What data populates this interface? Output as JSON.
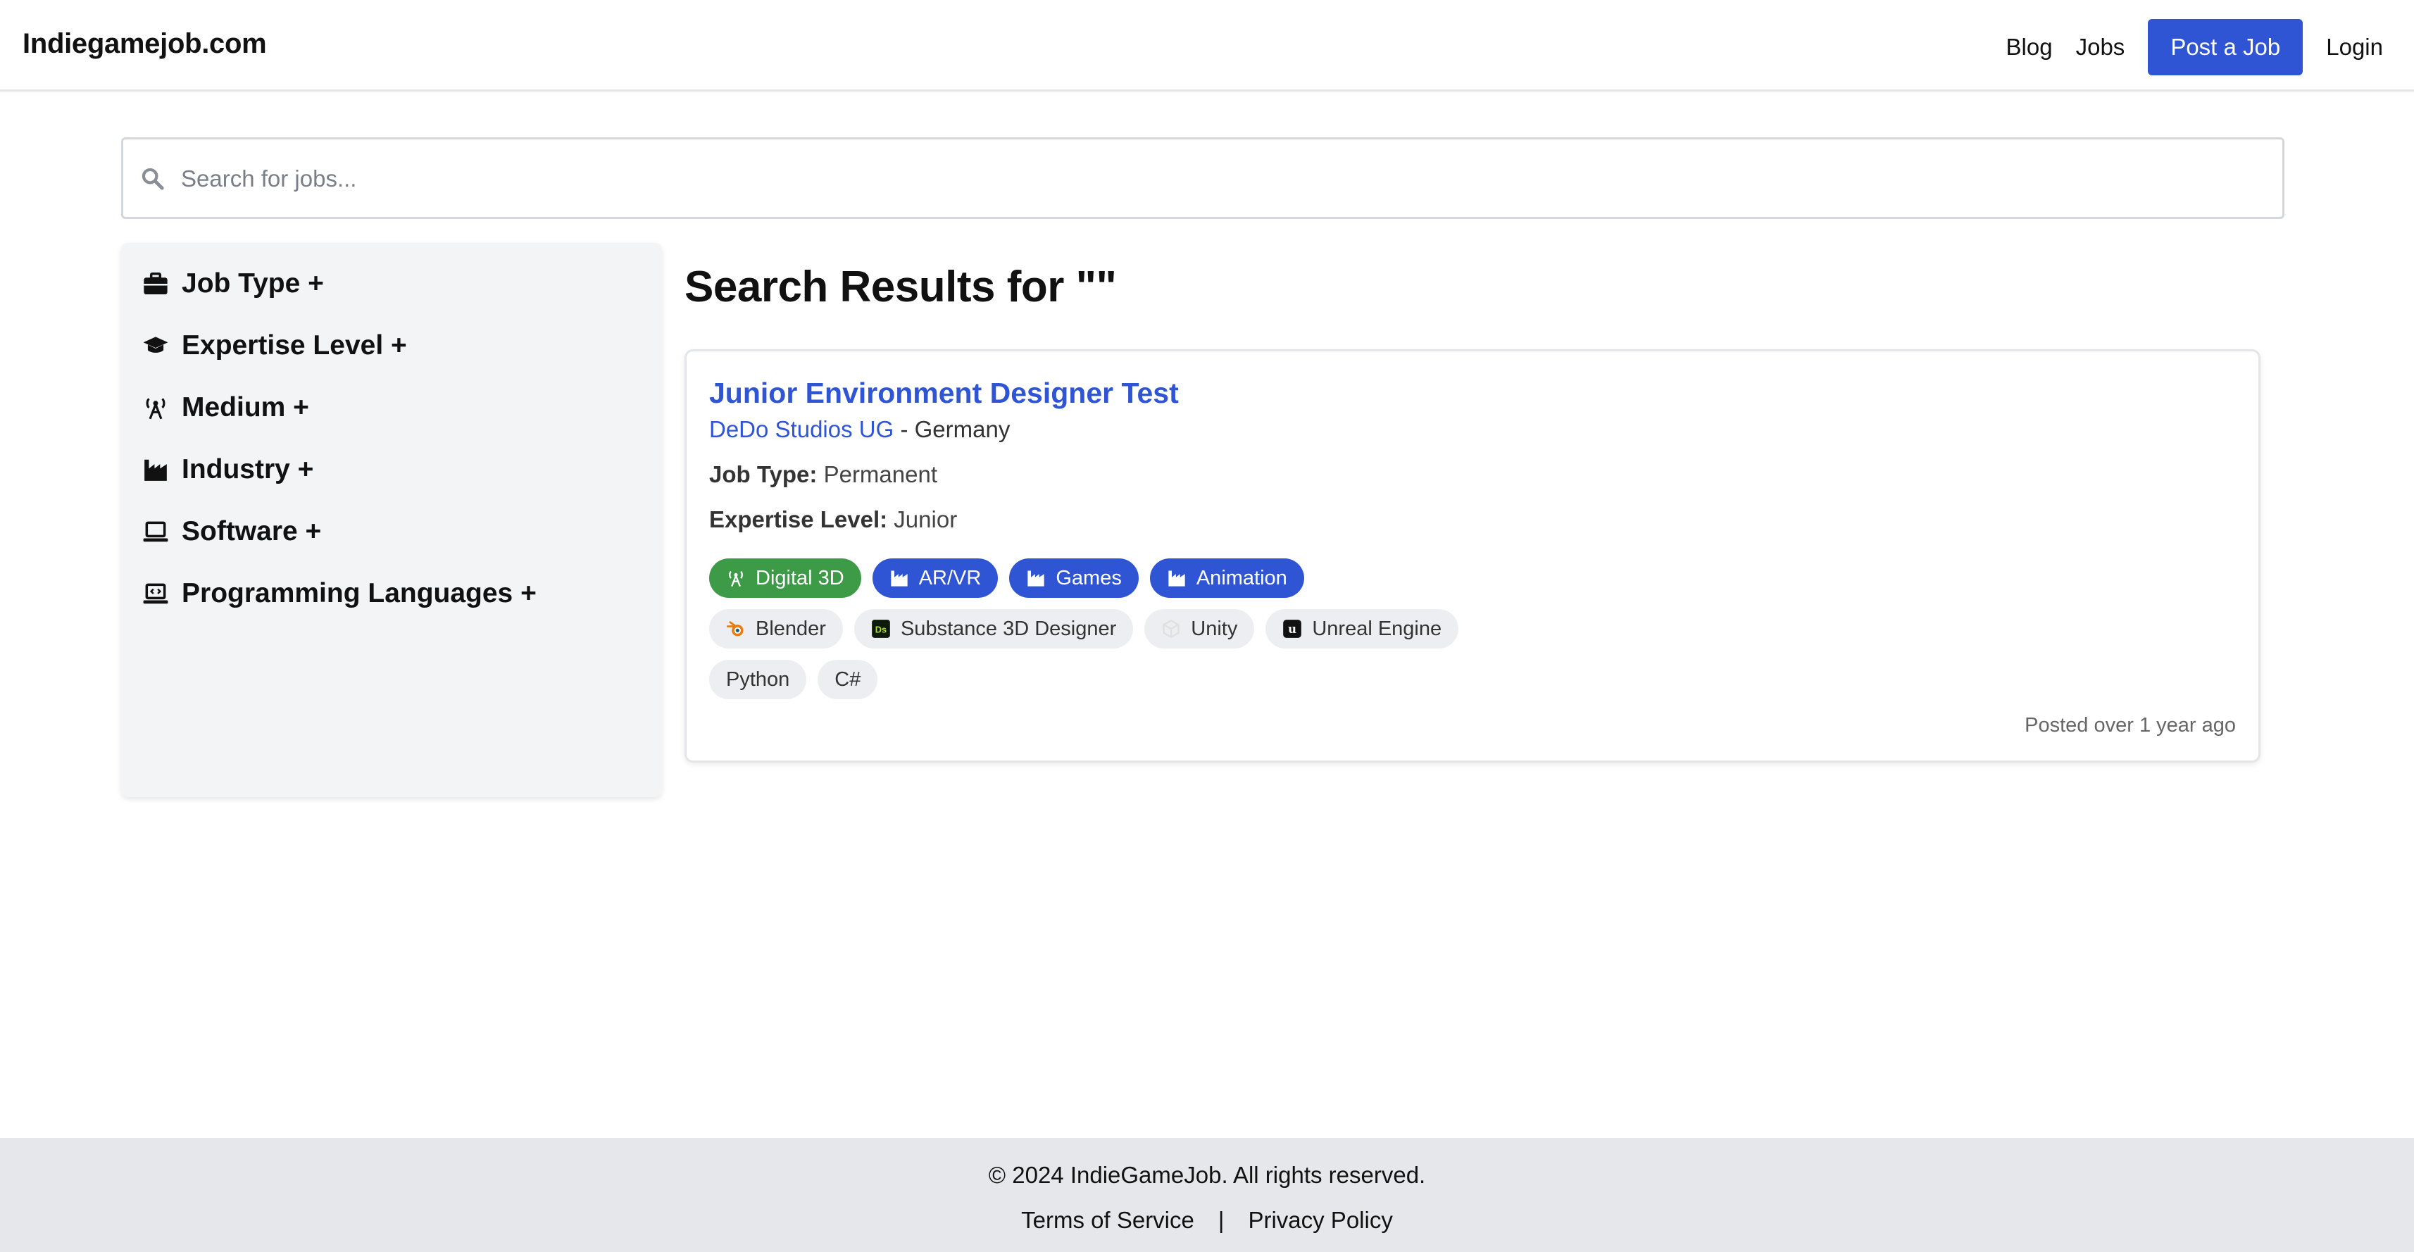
{
  "header": {
    "brand": "Indiegamejob.com",
    "nav": {
      "blog": "Blog",
      "jobs": "Jobs",
      "post_job": "Post a Job",
      "login": "Login"
    }
  },
  "search": {
    "placeholder": "Search for jobs...",
    "value": ""
  },
  "sidebar": {
    "filters": [
      {
        "label": "Job Type +",
        "icon": "briefcase-icon"
      },
      {
        "label": "Expertise Level +",
        "icon": "graduation-cap-icon"
      },
      {
        "label": "Medium +",
        "icon": "broadcast-tower-icon"
      },
      {
        "label": "Industry +",
        "icon": "industry-icon"
      },
      {
        "label": "Software +",
        "icon": "laptop-icon"
      },
      {
        "label": "Programming Languages +",
        "icon": "laptop-code-icon"
      }
    ]
  },
  "results": {
    "title": "Search Results for \"\"",
    "jobs": [
      {
        "title": "Junior Environment Designer Test",
        "company": "DeDo Studios UG",
        "location_sep": " - ",
        "location": "Germany",
        "job_type_label": "Job Type:",
        "job_type": "Permanent",
        "expertise_label": "Expertise Level:",
        "expertise": "Junior",
        "medium_tags": [
          "Digital 3D"
        ],
        "industry_tags": [
          "AR/VR",
          "Games",
          "Animation"
        ],
        "software_tags": [
          {
            "label": "Blender",
            "icon": "blender-icon"
          },
          {
            "label": "Substance 3D Designer",
            "icon": "substance-designer-icon"
          },
          {
            "label": "Unity",
            "icon": "unity-icon"
          },
          {
            "label": "Unreal Engine",
            "icon": "unreal-engine-icon"
          }
        ],
        "language_tags": [
          "Python",
          "C#"
        ],
        "posted": "Posted over 1 year ago"
      }
    ]
  },
  "footer": {
    "copyright": "© 2024 IndieGameJob. All rights reserved.",
    "terms": "Terms of Service",
    "separator": "|",
    "privacy": "Privacy Policy"
  },
  "colors": {
    "accent": "#2f55d4",
    "medium_tag": "#3d9a47",
    "tag_gray": "#eceef1",
    "footer_bg": "#e5e7eb"
  }
}
